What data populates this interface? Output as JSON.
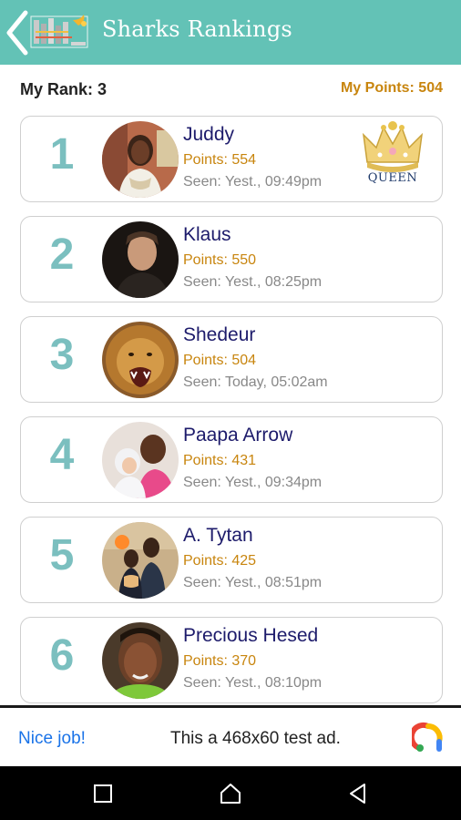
{
  "appbar": {
    "title": "Sharks Rankings"
  },
  "header": {
    "my_rank": "My Rank: 3",
    "my_points": "My Points: 504"
  },
  "rankings": [
    {
      "rank": "1",
      "name": "Juddy",
      "points": "Points: 554",
      "seen": "Seen: Yest., 09:49pm",
      "badge": "QUEEN"
    },
    {
      "rank": "2",
      "name": "Klaus",
      "points": "Points: 550",
      "seen": "Seen: Yest., 08:25pm"
    },
    {
      "rank": "3",
      "name": "Shedeur",
      "points": "Points: 504",
      "seen": "Seen: Today, 05:02am"
    },
    {
      "rank": "4",
      "name": "Paapa Arrow",
      "points": "Points: 431",
      "seen": "Seen: Yest., 09:34pm"
    },
    {
      "rank": "5",
      "name": "A. Tytan",
      "points": "Points: 425",
      "seen": "Seen: Yest., 08:51pm"
    },
    {
      "rank": "6",
      "name": "Precious Hesed",
      "points": "Points: 370",
      "seen": "Seen: Yest., 08:10pm"
    }
  ],
  "ad": {
    "left_text": "Nice job!",
    "text": "This a 468x60 test ad."
  },
  "icons": {
    "back": "back-arrow-icon",
    "crown": "crown-icon",
    "ad_logo": "ads-logo-icon",
    "nav_recent": "square-icon",
    "nav_home": "home-icon",
    "nav_back": "triangle-back-icon"
  },
  "colors": {
    "appbar": "#63c2b6",
    "rank": "#7bbfbf",
    "name": "#1d1b6b",
    "points": "#c8850e",
    "seen": "#888888",
    "ad_link": "#1a73e8"
  }
}
